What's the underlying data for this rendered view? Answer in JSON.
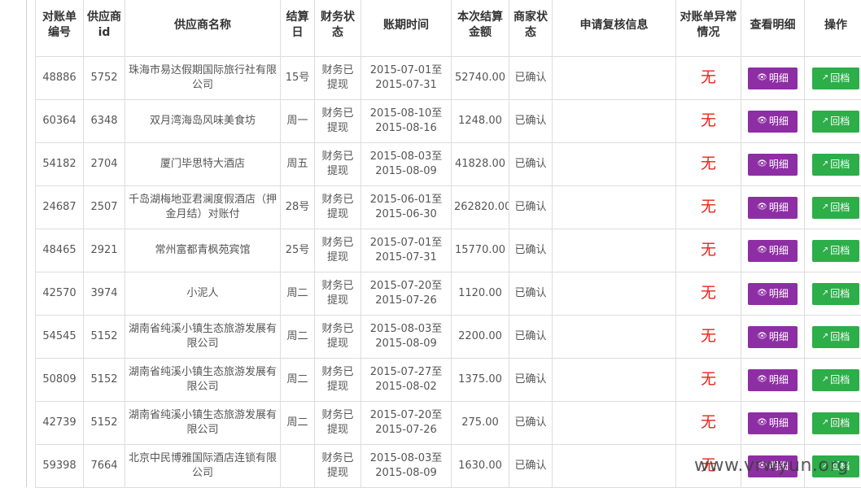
{
  "columns": [
    "对账单编号",
    "供应商id",
    "供应商名称",
    "结算日",
    "财务状态",
    "账期时间",
    "本次结算金额",
    "商家状态",
    "申请复核信息",
    "对账单异常情况",
    "查看明细",
    "操作"
  ],
  "rows": [
    {
      "id": "48886",
      "supplier_id": "5752",
      "name": "珠海市易达假期国际旅行社有限公司",
      "settle_day": "15号",
      "fin_status": "财务已提现",
      "period": "2015-07-01至2015-07-31",
      "amount": "52740.00",
      "merchant_status": "已确认",
      "review": "",
      "anomaly": "无",
      "detail_label": "明细",
      "archive_label": "回档"
    },
    {
      "id": "60364",
      "supplier_id": "6348",
      "name": "双月湾海岛风味美食坊",
      "settle_day": "周一",
      "fin_status": "财务已提现",
      "period": "2015-08-10至2015-08-16",
      "amount": "1248.00",
      "merchant_status": "已确认",
      "review": "",
      "anomaly": "无",
      "detail_label": "明细",
      "archive_label": "回档"
    },
    {
      "id": "54182",
      "supplier_id": "2704",
      "name": "厦门毕思特大酒店",
      "settle_day": "周五",
      "fin_status": "财务已提现",
      "period": "2015-08-03至2015-08-09",
      "amount": "41828.00",
      "merchant_status": "已确认",
      "review": "",
      "anomaly": "无",
      "detail_label": "明细",
      "archive_label": "回档"
    },
    {
      "id": "24687",
      "supplier_id": "2507",
      "name": "千岛湖梅地亚君澜度假酒店（押金月结）对账付",
      "settle_day": "28号",
      "fin_status": "财务已提现",
      "period": "2015-06-01至2015-06-30",
      "amount": "262820.00",
      "merchant_status": "已确认",
      "review": "",
      "anomaly": "无",
      "detail_label": "明细",
      "archive_label": "回档"
    },
    {
      "id": "48465",
      "supplier_id": "2921",
      "name": "常州富都青枫苑宾馆",
      "settle_day": "25号",
      "fin_status": "财务已提现",
      "period": "2015-07-01至2015-07-31",
      "amount": "15770.00",
      "merchant_status": "已确认",
      "review": "",
      "anomaly": "无",
      "detail_label": "明细",
      "archive_label": "回档"
    },
    {
      "id": "42570",
      "supplier_id": "3974",
      "name": "小泥人",
      "settle_day": "周二",
      "fin_status": "财务已提现",
      "period": "2015-07-20至2015-07-26",
      "amount": "1120.00",
      "merchant_status": "已确认",
      "review": "",
      "anomaly": "无",
      "detail_label": "明细",
      "archive_label": "回档"
    },
    {
      "id": "54545",
      "supplier_id": "5152",
      "name": "湖南省纯溪小镇生态旅游发展有限公司",
      "settle_day": "周二",
      "fin_status": "财务已提现",
      "period": "2015-08-03至2015-08-09",
      "amount": "2200.00",
      "merchant_status": "已确认",
      "review": "",
      "anomaly": "无",
      "detail_label": "明细",
      "archive_label": "回档"
    },
    {
      "id": "50809",
      "supplier_id": "5152",
      "name": "湖南省纯溪小镇生态旅游发展有限公司",
      "settle_day": "周二",
      "fin_status": "财务已提现",
      "period": "2015-07-27至2015-08-02",
      "amount": "1375.00",
      "merchant_status": "已确认",
      "review": "",
      "anomaly": "无",
      "detail_label": "明细",
      "archive_label": "回档"
    },
    {
      "id": "42739",
      "supplier_id": "5152",
      "name": "湖南省纯溪小镇生态旅游发展有限公司",
      "settle_day": "周二",
      "fin_status": "财务已提现",
      "period": "2015-07-20至2015-07-26",
      "amount": "275.00",
      "merchant_status": "已确认",
      "review": "",
      "anomaly": "无",
      "detail_label": "明细",
      "archive_label": "回档"
    },
    {
      "id": "59398",
      "supplier_id": "7664",
      "name": "北京中民博雅国际酒店连锁有限公司",
      "settle_day": "",
      "fin_status": "财务已提现",
      "period": "2015-08-03至2015-08-09",
      "amount": "1630.00",
      "merchant_status": "已确认",
      "review": "",
      "anomaly": "无",
      "detail_label": "明细",
      "archive_label": "回档"
    }
  ],
  "icons": {
    "detail": "eye-icon",
    "archive": "share-icon"
  },
  "colors": {
    "detail_button": "#8e2ea4",
    "archive_button": "#2cae49",
    "anomaly_text": "#e8231a"
  },
  "watermark": "www.vrwyun.org"
}
